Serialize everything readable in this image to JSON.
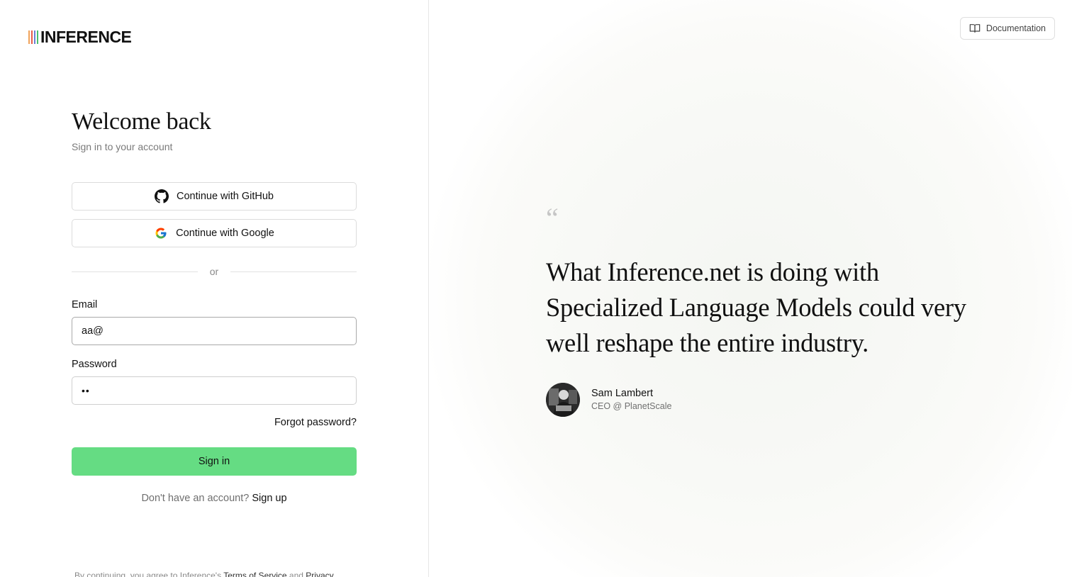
{
  "brand": {
    "name": "INFERENCE",
    "bar_colors": [
      "#f0a35b",
      "#e85d4a",
      "#6b7fd6",
      "#4cbf6d"
    ]
  },
  "login": {
    "title": "Welcome back",
    "subtitle": "Sign in to your account",
    "github_label": "Continue with GitHub",
    "google_label": "Continue with Google",
    "divider_text": "or",
    "email_label": "Email",
    "email_value": "aa@",
    "password_label": "Password",
    "password_masked": "••",
    "forgot_label": "Forgot password?",
    "signin_label": "Sign in",
    "signup_prompt": "Don't have an account?",
    "signup_link": "Sign up",
    "terms_prefix": "By continuing, you agree to Inference's",
    "terms_link": "Terms of Service",
    "terms_and": "and",
    "privacy_link": "Privacy"
  },
  "header": {
    "documentation_label": "Documentation"
  },
  "testimonial": {
    "quote_mark": "“",
    "quote": "What Inference.net is doing with Specialized Language Models could very well reshape the entire industry.",
    "author_name": "Sam Lambert",
    "author_role": "CEO @ PlanetScale"
  },
  "colors": {
    "accent_green": "#65dc83"
  },
  "icons": {
    "github": "github-icon",
    "google": "google-icon",
    "documentation": "book-icon"
  }
}
